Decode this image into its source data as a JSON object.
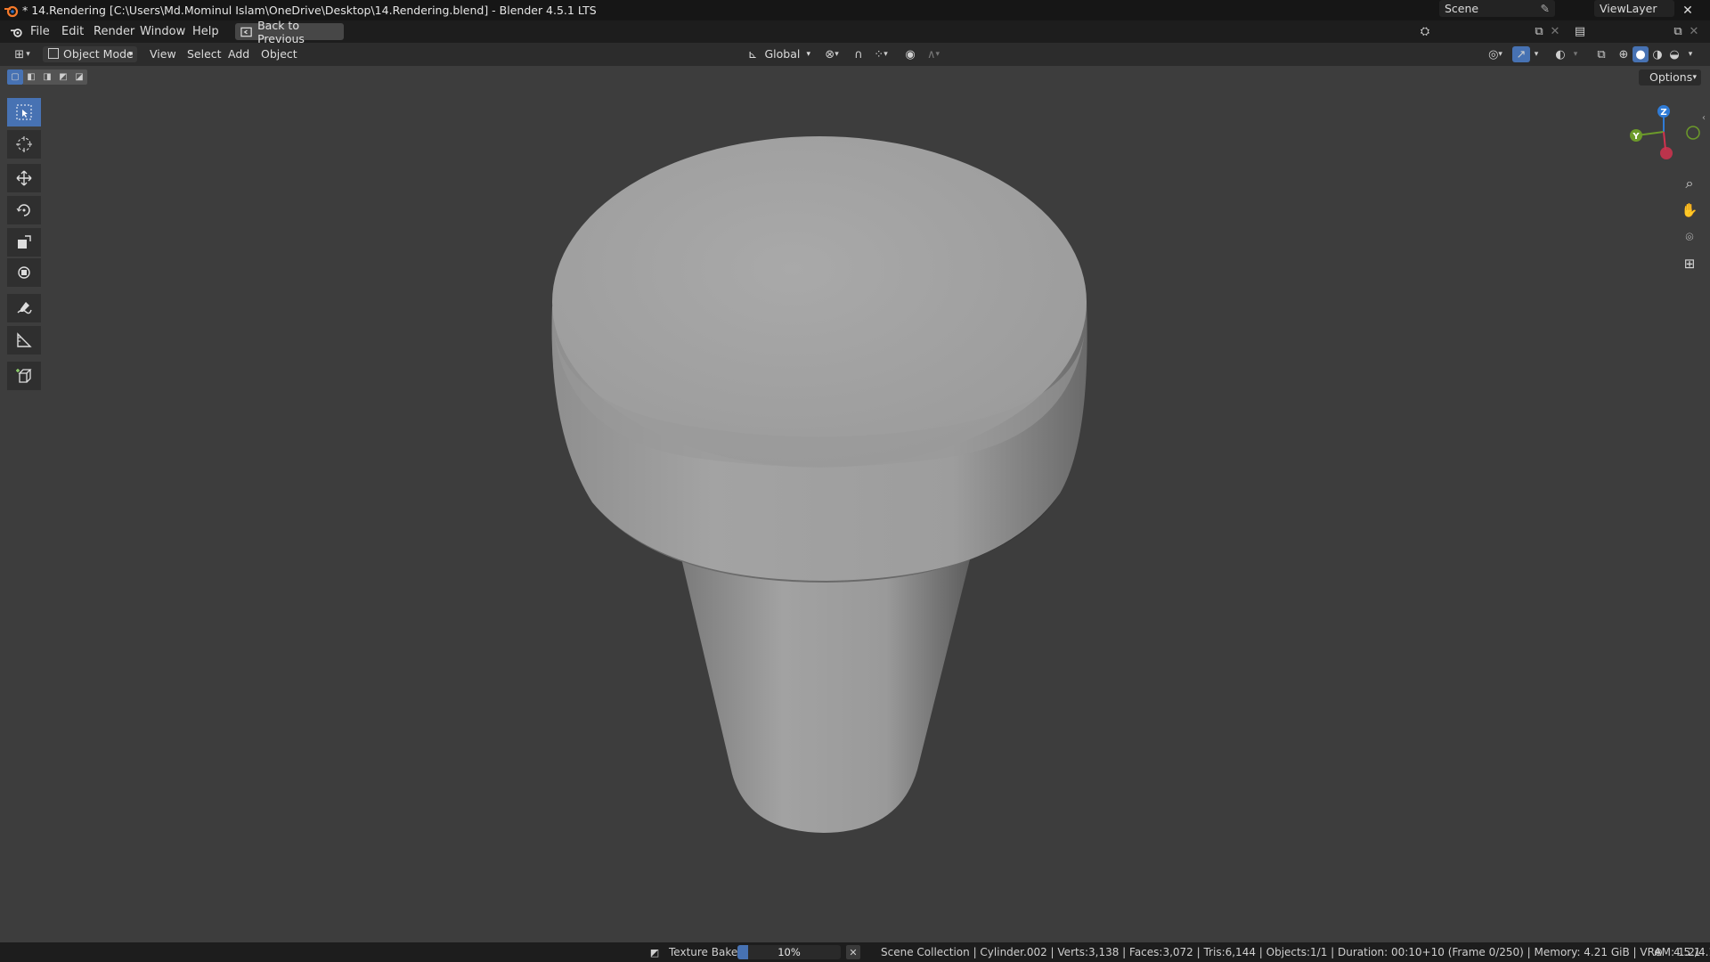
{
  "window": {
    "title": "* 14.Rendering [C:\\Users\\Md.Mominul Islam\\OneDrive\\Desktop\\14.Rendering.blend] - Blender 4.5.1 LTS",
    "minimize_glyph": "–",
    "maximize_glyph": "❐",
    "close_glyph": "✕"
  },
  "menubar": {
    "items": [
      "File",
      "Edit",
      "Render",
      "Window",
      "Help"
    ],
    "back_button": "Back to Previous",
    "scene": "Scene",
    "view_layer": "ViewLayer"
  },
  "viewport_header": {
    "mode": "Object Mode",
    "menus": [
      "View",
      "Select",
      "Add",
      "Object"
    ],
    "orientation": "Global",
    "options": "Options"
  },
  "gizmo": {
    "x_label": "",
    "y_label": "Y",
    "z_label": "Z",
    "colors": {
      "x": "#d1334f",
      "y": "#6c9a2a",
      "z": "#2f7bd6"
    }
  },
  "toolbar": {
    "tools": [
      "select-box-icon",
      "cursor-icon",
      "move-icon",
      "rotate-icon",
      "scale-icon",
      "transform-icon",
      "annotate-icon",
      "measure-icon",
      "add-cube-icon"
    ],
    "active_index": 0
  },
  "statusbar": {
    "job_label": "Texture Bake",
    "progress_text": "10%",
    "progress_fraction": 0.1,
    "stats": "Scene Collection | Cylinder.002 | Verts:3,138 | Faces:3,072 | Tris:6,144 | Objects:1/1 | Duration: 00:10+10 (Frame 0/250) | Memory: 4.21 GiB | VRAM: 1.2/4.1 GiB",
    "version": "4.5.1"
  },
  "colors": {
    "accent": "#4772b3",
    "viewport_bg": "#3d3d3d",
    "header_bg": "#1d1d1d"
  }
}
